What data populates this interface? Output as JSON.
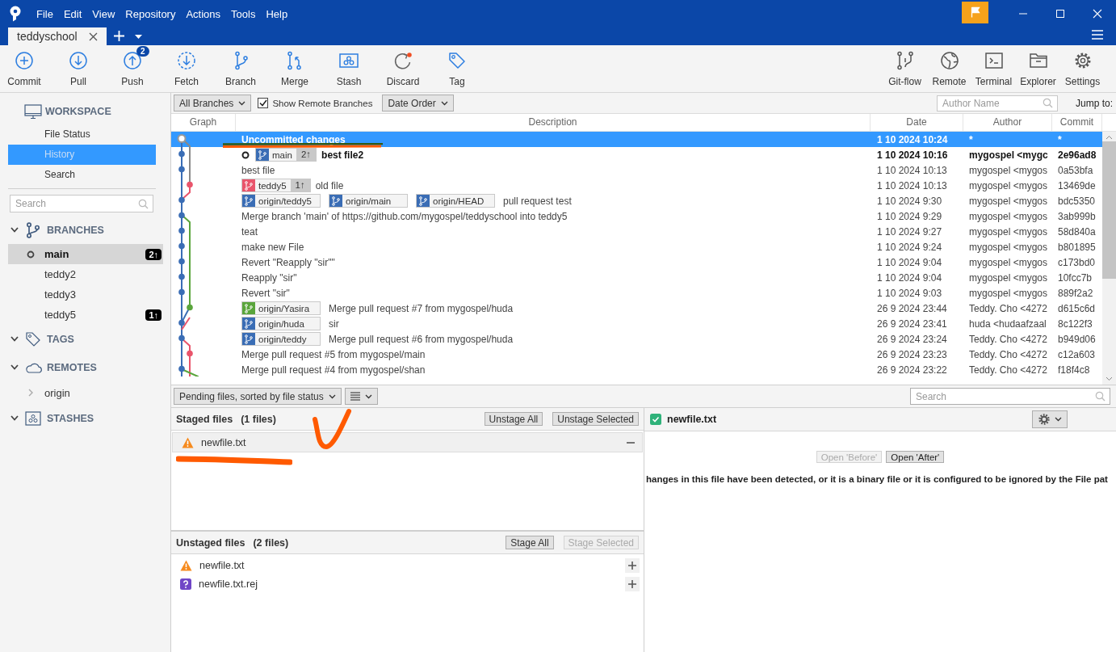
{
  "window": {
    "menu": [
      "File",
      "Edit",
      "View",
      "Repository",
      "Actions",
      "Tools",
      "Help"
    ],
    "tabs": [
      {
        "label": "teddyschool",
        "selected": true
      }
    ]
  },
  "toolbar": {
    "left": [
      {
        "kind": "commit",
        "label": "Commit"
      },
      {
        "kind": "pull",
        "label": "Pull"
      },
      {
        "kind": "push",
        "label": "Push",
        "badge": "2"
      },
      {
        "kind": "fetch",
        "label": "Fetch"
      },
      {
        "kind": "branch",
        "label": "Branch"
      },
      {
        "kind": "merge",
        "label": "Merge"
      },
      {
        "kind": "stash",
        "label": "Stash"
      },
      {
        "kind": "discard",
        "label": "Discard"
      },
      {
        "kind": "tag",
        "label": "Tag"
      }
    ],
    "right": [
      {
        "kind": "gitflow",
        "label": "Git-flow"
      },
      {
        "kind": "remote",
        "label": "Remote"
      },
      {
        "kind": "terminal",
        "label": "Terminal"
      },
      {
        "kind": "explorer",
        "label": "Explorer"
      },
      {
        "kind": "settings",
        "label": "Settings"
      }
    ]
  },
  "sidebar": {
    "workspace": {
      "title": "WORKSPACE",
      "items": [
        {
          "label": "File Status",
          "selected": false
        },
        {
          "label": "History",
          "selected": true
        },
        {
          "label": "Search",
          "selected": false
        }
      ]
    },
    "search_placeholder": "Search",
    "sections": [
      {
        "kind": "branches",
        "title": "BRANCHES",
        "expanded": true,
        "items": [
          {
            "label": "main",
            "selected": true,
            "current": true,
            "ahead": "2↑"
          },
          {
            "label": "teddy2",
            "selected": false,
            "current": false
          },
          {
            "label": "teddy3",
            "selected": false,
            "current": false
          },
          {
            "label": "teddy5",
            "selected": false,
            "current": false,
            "ahead": "1↑"
          }
        ]
      },
      {
        "kind": "tags",
        "title": "TAGS",
        "expanded": true
      },
      {
        "kind": "remotes",
        "title": "REMOTES",
        "expanded": true,
        "items": [
          {
            "label": "origin",
            "expanded": false
          }
        ]
      },
      {
        "kind": "stashes",
        "title": "STASHES",
        "expanded": true
      }
    ]
  },
  "history": {
    "branch_filter": "All Branches",
    "show_remote": {
      "label": "Show Remote Branches",
      "checked": true
    },
    "order": "Date Order",
    "author_placeholder": "Author Name",
    "jump_to": "Jump to:",
    "columns": [
      "Graph",
      "Description",
      "Date",
      "Author",
      "Commit"
    ],
    "rows": [
      {
        "description": "Uncommitted changes",
        "refs": [],
        "date": "1 10 2024 10:24",
        "author": "*",
        "commit": "*",
        "selected": true,
        "bold": true,
        "head": false
      },
      {
        "description": "best file2",
        "refs": [
          {
            "name": "main",
            "color": "#3a6db5",
            "ahead": "2↑"
          }
        ],
        "date": "1 10 2024 10:16",
        "author": "mygospel <mygc",
        "commit": "2e96ad8",
        "selected": false,
        "bold": true,
        "head": true
      },
      {
        "description": "best file",
        "refs": [],
        "date": "1 10 2024 10:13",
        "author": "mygospel <mygos",
        "commit": "0a53bfa",
        "selected": false,
        "bold": false,
        "head": false
      },
      {
        "description": "old file",
        "refs": [
          {
            "name": "teddy5",
            "color": "#e9546b",
            "ahead": "1↑"
          }
        ],
        "date": "1 10 2024 10:13",
        "author": "mygospel <mygos",
        "commit": "13469de",
        "selected": false,
        "bold": false,
        "head": false
      },
      {
        "description": "pull request test",
        "refs": [
          {
            "name": "origin/teddy5",
            "color": "#3a6db5"
          },
          {
            "name": "origin/main",
            "color": "#3a6db5"
          },
          {
            "name": "origin/HEAD",
            "color": "#3a6db5"
          }
        ],
        "date": "1 10 2024 9:30",
        "author": "mygospel <mygos",
        "commit": "bdc5350",
        "selected": false,
        "bold": false,
        "head": false
      },
      {
        "description": "Merge branch 'main' of https://github.com/mygospel/teddyschool into teddy5",
        "refs": [],
        "date": "1 10 2024 9:29",
        "author": "mygospel <mygos",
        "commit": "3ab999b",
        "selected": false,
        "bold": false,
        "head": false
      },
      {
        "description": "teat",
        "refs": [],
        "date": "1 10 2024 9:27",
        "author": "mygospel <mygos",
        "commit": "58d840a",
        "selected": false,
        "bold": false,
        "head": false
      },
      {
        "description": "make new File",
        "refs": [],
        "date": "1 10 2024 9:24",
        "author": "mygospel <mygos",
        "commit": "b801895",
        "selected": false,
        "bold": false,
        "head": false
      },
      {
        "description": "Revert \"Reapply \"sir\"\"",
        "refs": [],
        "date": "1 10 2024 9:04",
        "author": "mygospel <mygos",
        "commit": "c173bd0",
        "selected": false,
        "bold": false,
        "head": false
      },
      {
        "description": "Reapply \"sir\"",
        "refs": [],
        "date": "1 10 2024 9:04",
        "author": "mygospel <mygos",
        "commit": "10fcc7b",
        "selected": false,
        "bold": false,
        "head": false
      },
      {
        "description": "Revert \"sir\"",
        "refs": [],
        "date": "1 10 2024 9:03",
        "author": "mygospel <mygos",
        "commit": "889f2a2",
        "selected": false,
        "bold": false,
        "head": false
      },
      {
        "description": "Merge pull request #7 from mygospel/huda",
        "refs": [
          {
            "name": "origin/Yasira",
            "color": "#5aa53c"
          }
        ],
        "date": "26 9 2024 23:44",
        "author": "Teddy. Cho <4272",
        "commit": "d615c6d",
        "selected": false,
        "bold": false,
        "head": false
      },
      {
        "description": "sir",
        "refs": [
          {
            "name": "origin/huda",
            "color": "#3a6db5"
          }
        ],
        "date": "26 9 2024 23:41",
        "author": "huda <hudaafzaal",
        "commit": "8c122f3",
        "selected": false,
        "bold": false,
        "head": false
      },
      {
        "description": "Merge pull request #6 from mygospel/huda",
        "refs": [
          {
            "name": "origin/teddy",
            "color": "#3a6db5"
          }
        ],
        "date": "26 9 2024 23:24",
        "author": "Teddy. Cho <4272",
        "commit": "b949d06",
        "selected": false,
        "bold": false,
        "head": false
      },
      {
        "description": "Merge pull request #5 from mygospel/main",
        "refs": [],
        "date": "26 9 2024 23:23",
        "author": "Teddy. Cho <4272",
        "commit": "c12a603",
        "selected": false,
        "bold": false,
        "head": false
      },
      {
        "description": "Merge pull request #4 from mygospel/shan",
        "refs": [],
        "date": "26 9 2024 23:22",
        "author": "Teddy. Cho <4272",
        "commit": "f18f4c8",
        "selected": false,
        "bold": false,
        "head": false
      }
    ]
  },
  "pending": {
    "sort": "Pending files, sorted by file status",
    "search_placeholder": "Search",
    "groups": [
      {
        "title": "Staged files",
        "count": "(1 files)",
        "kind": "staged",
        "buttons": [
          {
            "label": "Unstage All",
            "disabled": false
          },
          {
            "label": "Unstage Selected",
            "disabled": false
          }
        ],
        "files": [
          {
            "name": "newfile.txt",
            "kind": "conflict",
            "selected": true
          }
        ]
      },
      {
        "title": "Unstaged files",
        "count": "(2 files)",
        "kind": "unstaged",
        "buttons": [
          {
            "label": "Stage All",
            "disabled": false
          },
          {
            "label": "Stage Selected",
            "disabled": true
          }
        ],
        "files": [
          {
            "name": "newfile.txt",
            "kind": "conflict",
            "selected": false
          },
          {
            "name": "newfile.txt.rej",
            "kind": "unknown",
            "selected": false
          }
        ]
      }
    ]
  },
  "diff": {
    "file": "newfile.txt",
    "checked": true,
    "buttons": [
      {
        "label": "Open 'Before'",
        "disabled": true
      },
      {
        "label": "Open 'After'",
        "disabled": false
      }
    ],
    "message": "hanges in this file have been detected, or it is a binary file or it is configured to be ignored by the File pat"
  }
}
